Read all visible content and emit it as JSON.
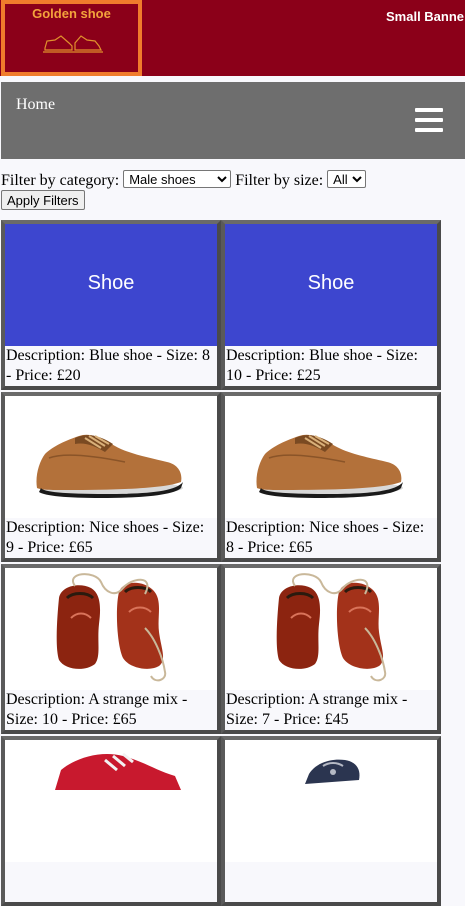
{
  "header": {
    "logo_title": "Golden shoe",
    "small_banner": "Small Banne"
  },
  "nav": {
    "home": "Home"
  },
  "filters": {
    "category_label": "Filter by category:",
    "category_value": "Male shoes",
    "size_label": "Filter by size:",
    "size_value": "All",
    "apply_label": "Apply Filters"
  },
  "products": [
    {
      "image": "placeholder",
      "placeholder_text": "Shoe",
      "description": "Description: Blue shoe - Size: 8 - Price: £20"
    },
    {
      "image": "placeholder",
      "placeholder_text": "Shoe",
      "description": "Description: Blue shoe - Size: 10 - Price: £25"
    },
    {
      "image": "brown-oxford",
      "description": "Description: Nice shoes - Size: 9 - Price: £65"
    },
    {
      "image": "brown-oxford",
      "description": "Description: Nice shoes - Size: 8 - Price: £65"
    },
    {
      "image": "red-boots",
      "description": "Description: A strange mix - Size: 10 - Price: £65"
    },
    {
      "image": "red-boots",
      "description": "Description: A strange mix - Size: 7 - Price: £45"
    },
    {
      "image": "red-sneaker",
      "description": ""
    },
    {
      "image": "navy-sneaker",
      "description": ""
    }
  ],
  "colors": {
    "header_bg": "#8b0019",
    "logo_border": "#f07c2c",
    "nav_bg": "#6e6e6e",
    "placeholder_bg": "#3d46cf"
  }
}
